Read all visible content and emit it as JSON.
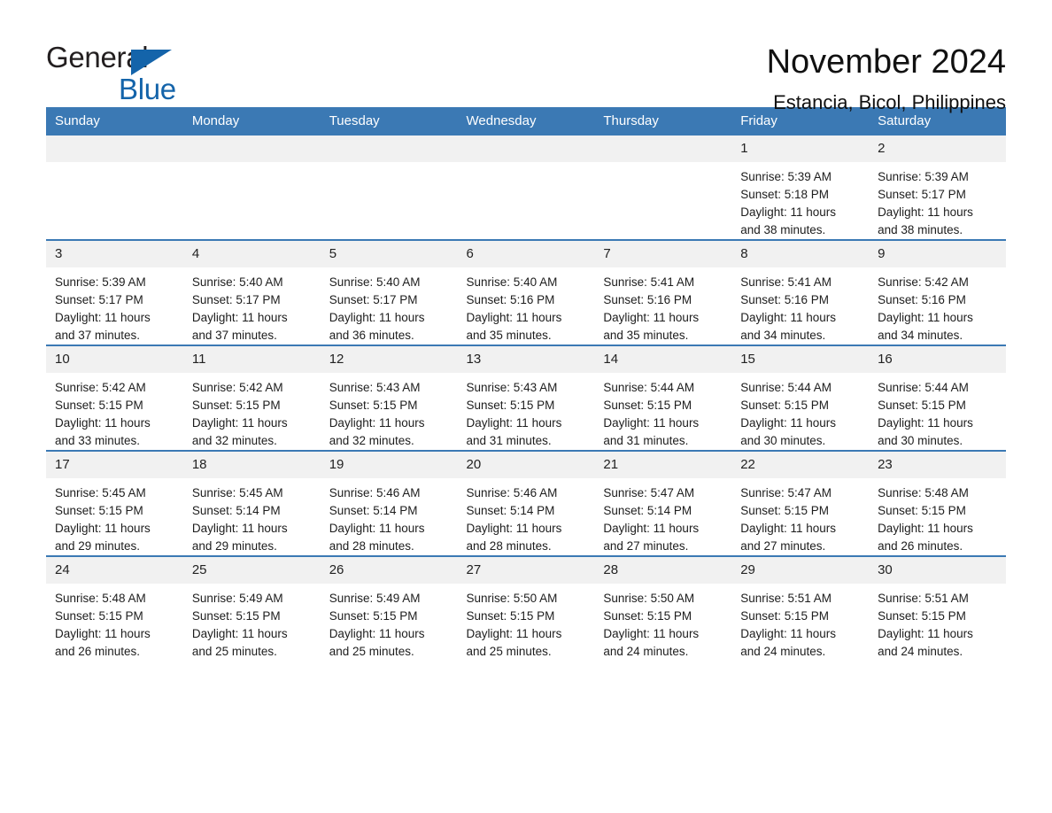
{
  "brand": {
    "name_part1": "General",
    "name_part2": "Blue",
    "accent_color": "#1464aa"
  },
  "header": {
    "title": "November 2024",
    "location": "Estancia, Bicol, Philippines"
  },
  "theme": {
    "header_blue": "#3b79b4",
    "daynum_band": "#f1f1f1",
    "text": "#1d1d1d"
  },
  "weekdays": [
    "Sunday",
    "Monday",
    "Tuesday",
    "Wednesday",
    "Thursday",
    "Friday",
    "Saturday"
  ],
  "labels": {
    "sunrise_prefix": "Sunrise:",
    "sunset_prefix": "Sunset:",
    "daylight_prefix": "Daylight:"
  },
  "weeks": [
    [
      {
        "day": "",
        "empty": true
      },
      {
        "day": "",
        "empty": true
      },
      {
        "day": "",
        "empty": true
      },
      {
        "day": "",
        "empty": true
      },
      {
        "day": "",
        "empty": true
      },
      {
        "day": "1",
        "sunrise": "Sunrise: 5:39 AM",
        "sunset": "Sunset: 5:18 PM",
        "daylight": "Daylight: 11 hours and 38 minutes."
      },
      {
        "day": "2",
        "sunrise": "Sunrise: 5:39 AM",
        "sunset": "Sunset: 5:17 PM",
        "daylight": "Daylight: 11 hours and 38 minutes."
      }
    ],
    [
      {
        "day": "3",
        "sunrise": "Sunrise: 5:39 AM",
        "sunset": "Sunset: 5:17 PM",
        "daylight": "Daylight: 11 hours and 37 minutes."
      },
      {
        "day": "4",
        "sunrise": "Sunrise: 5:40 AM",
        "sunset": "Sunset: 5:17 PM",
        "daylight": "Daylight: 11 hours and 37 minutes."
      },
      {
        "day": "5",
        "sunrise": "Sunrise: 5:40 AM",
        "sunset": "Sunset: 5:17 PM",
        "daylight": "Daylight: 11 hours and 36 minutes."
      },
      {
        "day": "6",
        "sunrise": "Sunrise: 5:40 AM",
        "sunset": "Sunset: 5:16 PM",
        "daylight": "Daylight: 11 hours and 35 minutes."
      },
      {
        "day": "7",
        "sunrise": "Sunrise: 5:41 AM",
        "sunset": "Sunset: 5:16 PM",
        "daylight": "Daylight: 11 hours and 35 minutes."
      },
      {
        "day": "8",
        "sunrise": "Sunrise: 5:41 AM",
        "sunset": "Sunset: 5:16 PM",
        "daylight": "Daylight: 11 hours and 34 minutes."
      },
      {
        "day": "9",
        "sunrise": "Sunrise: 5:42 AM",
        "sunset": "Sunset: 5:16 PM",
        "daylight": "Daylight: 11 hours and 34 minutes."
      }
    ],
    [
      {
        "day": "10",
        "sunrise": "Sunrise: 5:42 AM",
        "sunset": "Sunset: 5:15 PM",
        "daylight": "Daylight: 11 hours and 33 minutes."
      },
      {
        "day": "11",
        "sunrise": "Sunrise: 5:42 AM",
        "sunset": "Sunset: 5:15 PM",
        "daylight": "Daylight: 11 hours and 32 minutes."
      },
      {
        "day": "12",
        "sunrise": "Sunrise: 5:43 AM",
        "sunset": "Sunset: 5:15 PM",
        "daylight": "Daylight: 11 hours and 32 minutes."
      },
      {
        "day": "13",
        "sunrise": "Sunrise: 5:43 AM",
        "sunset": "Sunset: 5:15 PM",
        "daylight": "Daylight: 11 hours and 31 minutes."
      },
      {
        "day": "14",
        "sunrise": "Sunrise: 5:44 AM",
        "sunset": "Sunset: 5:15 PM",
        "daylight": "Daylight: 11 hours and 31 minutes."
      },
      {
        "day": "15",
        "sunrise": "Sunrise: 5:44 AM",
        "sunset": "Sunset: 5:15 PM",
        "daylight": "Daylight: 11 hours and 30 minutes."
      },
      {
        "day": "16",
        "sunrise": "Sunrise: 5:44 AM",
        "sunset": "Sunset: 5:15 PM",
        "daylight": "Daylight: 11 hours and 30 minutes."
      }
    ],
    [
      {
        "day": "17",
        "sunrise": "Sunrise: 5:45 AM",
        "sunset": "Sunset: 5:15 PM",
        "daylight": "Daylight: 11 hours and 29 minutes."
      },
      {
        "day": "18",
        "sunrise": "Sunrise: 5:45 AM",
        "sunset": "Sunset: 5:14 PM",
        "daylight": "Daylight: 11 hours and 29 minutes."
      },
      {
        "day": "19",
        "sunrise": "Sunrise: 5:46 AM",
        "sunset": "Sunset: 5:14 PM",
        "daylight": "Daylight: 11 hours and 28 minutes."
      },
      {
        "day": "20",
        "sunrise": "Sunrise: 5:46 AM",
        "sunset": "Sunset: 5:14 PM",
        "daylight": "Daylight: 11 hours and 28 minutes."
      },
      {
        "day": "21",
        "sunrise": "Sunrise: 5:47 AM",
        "sunset": "Sunset: 5:14 PM",
        "daylight": "Daylight: 11 hours and 27 minutes."
      },
      {
        "day": "22",
        "sunrise": "Sunrise: 5:47 AM",
        "sunset": "Sunset: 5:15 PM",
        "daylight": "Daylight: 11 hours and 27 minutes."
      },
      {
        "day": "23",
        "sunrise": "Sunrise: 5:48 AM",
        "sunset": "Sunset: 5:15 PM",
        "daylight": "Daylight: 11 hours and 26 minutes."
      }
    ],
    [
      {
        "day": "24",
        "sunrise": "Sunrise: 5:48 AM",
        "sunset": "Sunset: 5:15 PM",
        "daylight": "Daylight: 11 hours and 26 minutes."
      },
      {
        "day": "25",
        "sunrise": "Sunrise: 5:49 AM",
        "sunset": "Sunset: 5:15 PM",
        "daylight": "Daylight: 11 hours and 25 minutes."
      },
      {
        "day": "26",
        "sunrise": "Sunrise: 5:49 AM",
        "sunset": "Sunset: 5:15 PM",
        "daylight": "Daylight: 11 hours and 25 minutes."
      },
      {
        "day": "27",
        "sunrise": "Sunrise: 5:50 AM",
        "sunset": "Sunset: 5:15 PM",
        "daylight": "Daylight: 11 hours and 25 minutes."
      },
      {
        "day": "28",
        "sunrise": "Sunrise: 5:50 AM",
        "sunset": "Sunset: 5:15 PM",
        "daylight": "Daylight: 11 hours and 24 minutes."
      },
      {
        "day": "29",
        "sunrise": "Sunrise: 5:51 AM",
        "sunset": "Sunset: 5:15 PM",
        "daylight": "Daylight: 11 hours and 24 minutes."
      },
      {
        "day": "30",
        "sunrise": "Sunrise: 5:51 AM",
        "sunset": "Sunset: 5:15 PM",
        "daylight": "Daylight: 11 hours and 24 minutes."
      }
    ]
  ]
}
